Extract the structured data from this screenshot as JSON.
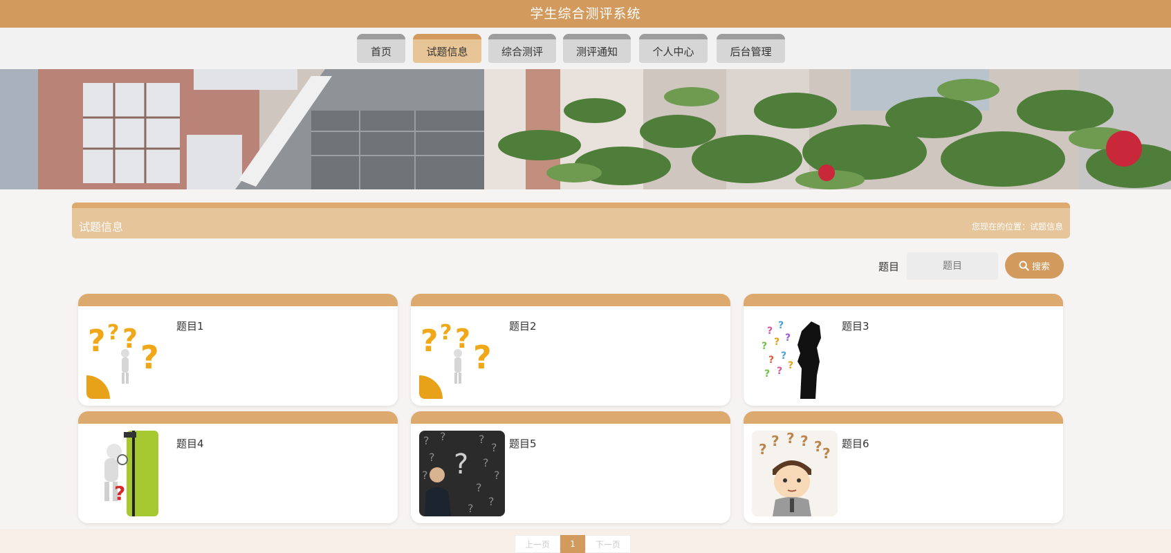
{
  "header": {
    "title": "学生综合测评系统"
  },
  "nav": [
    {
      "label": "首页"
    },
    {
      "label": "试题信息"
    },
    {
      "label": "综合测评"
    },
    {
      "label": "测评通知"
    },
    {
      "label": "个人中心"
    },
    {
      "label": "后台管理"
    }
  ],
  "section": {
    "title": "试题信息",
    "breadcrumb": "您现在的位置：试题信息"
  },
  "search": {
    "label": "题目",
    "placeholder": "题目",
    "button_label": "搜索"
  },
  "cards": [
    {
      "title": "题目1"
    },
    {
      "title": "题目2"
    },
    {
      "title": "题目3"
    },
    {
      "title": "题目4"
    },
    {
      "title": "题目5"
    },
    {
      "title": "题目6"
    }
  ],
  "pagination": {
    "prev": "上一页",
    "current": "1",
    "next": "下一页"
  },
  "colors": {
    "accent": "#d39a5d",
    "light_accent": "#e8c596"
  }
}
